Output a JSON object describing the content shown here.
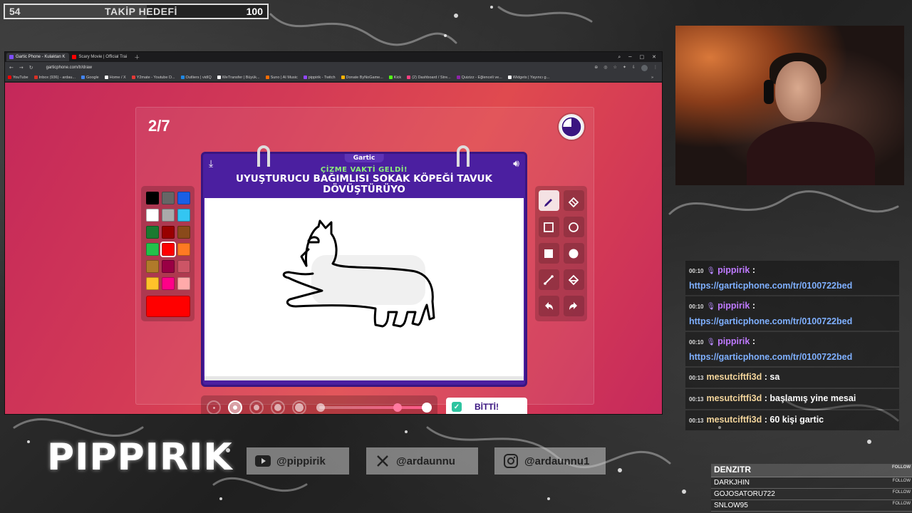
{
  "goal": {
    "current": "54",
    "label": "TAKİP HEDEFİ",
    "target": "100",
    "progress": 0.54
  },
  "browser": {
    "tabs": [
      {
        "label": "Gartic Phone - Kulaktan K",
        "active": true,
        "color": "#7c4dff"
      },
      {
        "label": "Scary Movie | Official Trai",
        "active": false,
        "color": "#ff0000"
      }
    ],
    "url": "garticphone.com/tr/draw",
    "bookmarks": [
      {
        "label": "YouTube",
        "color": "#ff0000"
      },
      {
        "label": "Inbox (936) - ardau...",
        "color": "#d93025"
      },
      {
        "label": "Google",
        "color": "#4285f4"
      },
      {
        "label": "Home / X",
        "color": "#ffffff"
      },
      {
        "label": "Y2mate - Youtube D...",
        "color": "#e53935"
      },
      {
        "label": "Outliers | vidIQ",
        "color": "#1e88e5"
      },
      {
        "label": "WeTransfer | Büyük...",
        "color": "#ffffff"
      },
      {
        "label": "Suno | AI Music",
        "color": "#ff6d00"
      },
      {
        "label": "pippirik - Twitch",
        "color": "#9146ff"
      },
      {
        "label": "Donate ByNoGame...",
        "color": "#ffb300"
      },
      {
        "label": "Kick",
        "color": "#53fc18"
      },
      {
        "label": "(2) Dashboard / Stre...",
        "color": "#ff4081"
      },
      {
        "label": "Quizizz - Eğlenceli ve...",
        "color": "#8e24aa"
      },
      {
        "label": "Widgets | Yayıncı g...",
        "color": "#ffffff"
      }
    ]
  },
  "game": {
    "round": "2/7",
    "brand": "Gartic",
    "subtitle": "ÇİZME VAKTİ GELDİ!",
    "prompt": "UYUŞTURUCU BAĞIMLISI SOKAK KÖPEĞİ TAVUK DÖVÜŞTÜRÜYO",
    "done_label": "BİTTİ!",
    "selected_color": "#ff0000",
    "palette": [
      "#000000",
      "#666666",
      "#1a5fe6",
      "#ffffff",
      "#aaaaaa",
      "#33c6f2",
      "#1a7a30",
      "#990000",
      "#8a4a1a",
      "#22c24a",
      "#ff0000",
      "#ff7a22",
      "#b07a2a",
      "#990044",
      "#cc5566",
      "#ffc22a",
      "#ff0088",
      "#ffaaaa"
    ],
    "tools": [
      "pencil-tool",
      "eraser-tool",
      "rectangle-outline-tool",
      "circle-outline-tool",
      "rectangle-fill-tool",
      "circle-fill-tool",
      "line-tool",
      "fill-tool",
      "undo-tool",
      "redo-tool"
    ]
  },
  "chat": [
    {
      "time": "00:10",
      "user": "pippirik",
      "text": ":",
      "link": "https://garticphone.com/tr/0100722bed",
      "mod": true
    },
    {
      "time": "00:10",
      "user": "pippirik",
      "text": ":",
      "link": "https://garticphone.com/tr/0100722bed",
      "mod": true
    },
    {
      "time": "00:10",
      "user": "pippirik",
      "text": ":",
      "link": "https://garticphone.com/tr/0100722bed",
      "mod": true
    },
    {
      "time": "00:13",
      "user": "mesutciftfi3d",
      "text": ": sa",
      "mod": false
    },
    {
      "time": "00:13",
      "user": "mesutciftfi3d",
      "text": ": başlamış yine mesai",
      "mod": false
    },
    {
      "time": "00:13",
      "user": "mesutciftfi3d",
      "text": ": 60 kişi gartic",
      "mod": false
    }
  ],
  "branding": {
    "name": "PIPPIRIK",
    "youtube": "@pippirik",
    "x": "@ardaunnu",
    "instagram": "@ardaunnu1"
  },
  "followers": {
    "follow_label": "FOLLOW",
    "names": [
      "DENZITR",
      "DARKJHIN",
      "GOJOSATORU722",
      "SNLOW95"
    ]
  }
}
